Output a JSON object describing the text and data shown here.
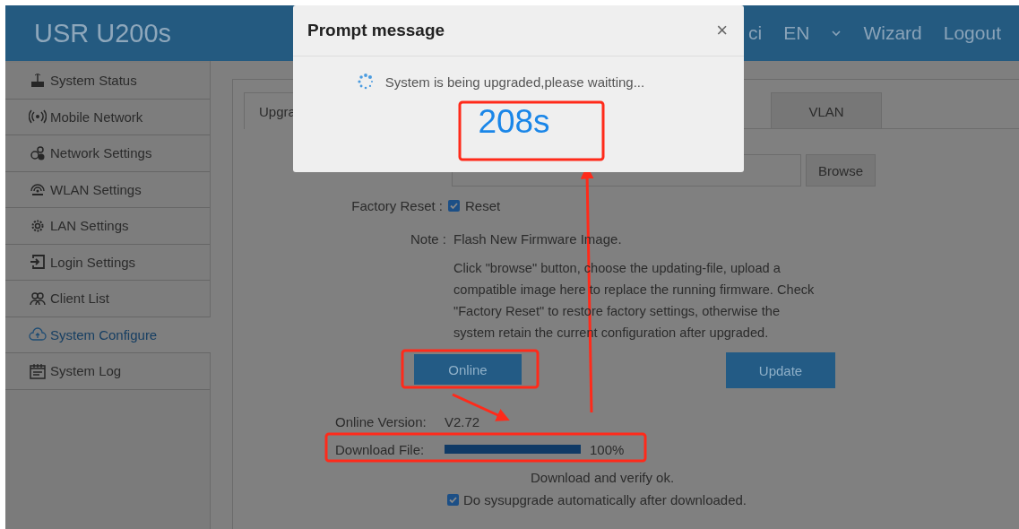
{
  "header": {
    "logo": "USR U200s",
    "partial_item": "ci",
    "language": "EN",
    "links": [
      "Wizard",
      "Logout"
    ]
  },
  "sidebar": {
    "items": [
      {
        "label": "System Status",
        "selected": false
      },
      {
        "label": "Mobile Network",
        "selected": false
      },
      {
        "label": "Network Settings",
        "selected": false
      },
      {
        "label": "WLAN Settings",
        "selected": false
      },
      {
        "label": "LAN Settings",
        "selected": false
      },
      {
        "label": "Login Settings",
        "selected": false
      },
      {
        "label": "Client List",
        "selected": false
      },
      {
        "label": "System Configure",
        "selected": true
      },
      {
        "label": "System Log",
        "selected": false
      }
    ]
  },
  "tabs": [
    {
      "label": "Upgra",
      "selected": true
    },
    {
      "label": "VLAN",
      "selected": false
    }
  ],
  "form": {
    "browse_button": "Browse",
    "factory_reset": {
      "label": "Factory Reset :",
      "option": "Reset",
      "checked": true
    },
    "note": {
      "label": "Note :",
      "title": "Flash New Firmware Image.",
      "text": "Click \"browse\" button, choose the updating-file, upload a compatible image here to replace the running firmware. Check \"Factory Reset\" to restore factory settings, otherwise the system retain the current configuration after upgraded."
    },
    "online_button": "Online",
    "update_button": "Update",
    "online_version": {
      "label": "Online Version:",
      "value": "V2.72"
    },
    "download": {
      "label": "Download File:",
      "level": 1,
      "reading": "100%"
    },
    "status": "Download and verify ok.",
    "auto_upgrade": {
      "label": "Do sysupgrade automatically after downloaded.",
      "checked": true
    }
  },
  "dialog": {
    "title": "Prompt message",
    "close": "×",
    "message": "System is being upgraded,please waitting...",
    "countdown": "208s"
  }
}
